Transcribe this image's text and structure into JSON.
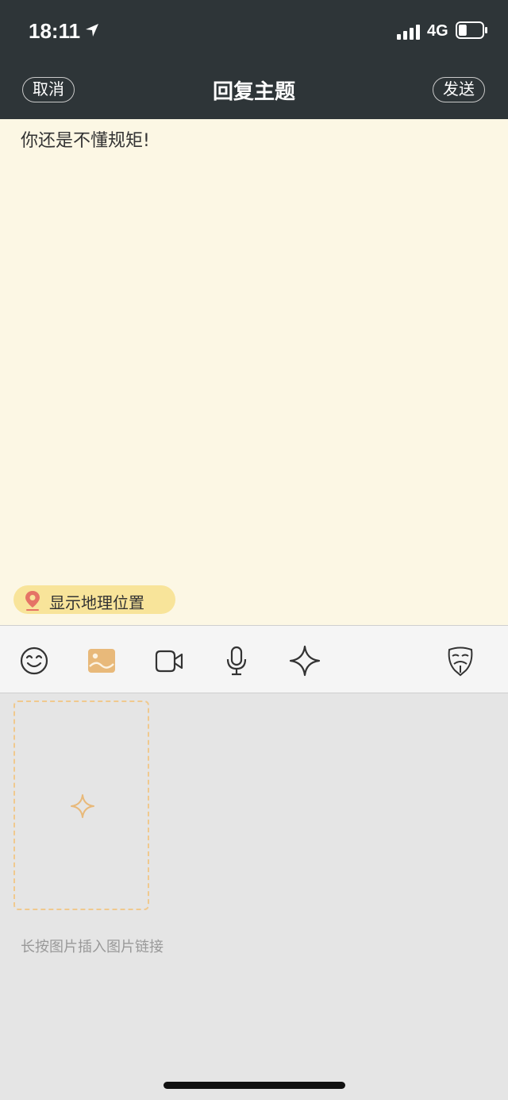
{
  "status_bar": {
    "time": "18:11",
    "network": "4G",
    "battery_level": 0.35
  },
  "nav": {
    "cancel_label": "取消",
    "title": "回复主题",
    "send_label": "发送"
  },
  "editor": {
    "text": "你还是不懂规矩!",
    "location_label": "显示地理位置"
  },
  "toolbar": {
    "tools": [
      "emoji-icon",
      "image-icon",
      "video-icon",
      "microphone-icon",
      "plus-icon",
      "anonymous-mask-icon"
    ],
    "active_tool": "image-icon",
    "accent_color": "#e8b97a"
  },
  "attachments": {
    "hint": "长按图片插入图片链接"
  },
  "colors": {
    "header_bg": "#2e3538",
    "editor_bg": "#fcf7e4",
    "chip_bg": "#f8e49a",
    "pin_color": "#e57366"
  }
}
